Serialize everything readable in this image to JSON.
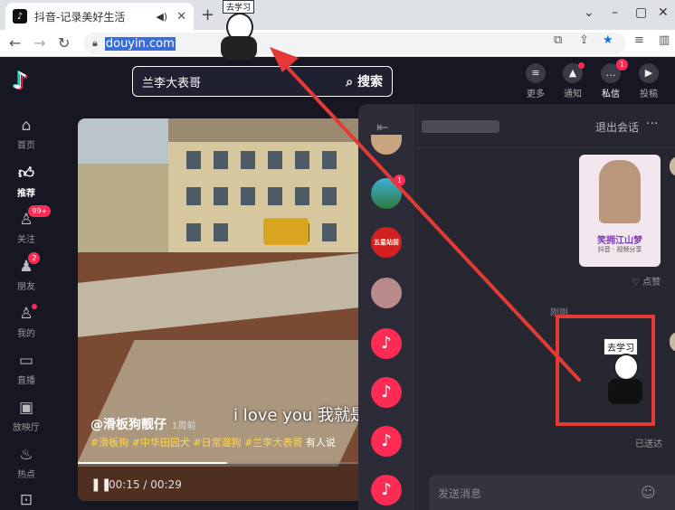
{
  "browser": {
    "tab_title": "抖音-记录美好生活",
    "url": "douyin.com",
    "accent": "#1a73e8"
  },
  "header": {
    "search_value": "兰李大表哥",
    "search_button": "搜索",
    "items": [
      {
        "label": "更多",
        "icon": "menu-icon"
      },
      {
        "label": "通知",
        "icon": "bell-icon"
      },
      {
        "label": "私信",
        "icon": "message-icon",
        "badge": "1"
      },
      {
        "label": "投稿",
        "icon": "upload-icon"
      }
    ]
  },
  "sidebar": {
    "items": [
      {
        "label": "首页",
        "icon": "home-icon"
      },
      {
        "label": "推荐",
        "icon": "thumbs-up-icon"
      },
      {
        "label": "关注",
        "icon": "follow-icon",
        "badge": "99+"
      },
      {
        "label": "朋友",
        "icon": "friends-icon",
        "badge": "2"
      },
      {
        "label": "我的",
        "icon": "profile-icon"
      },
      {
        "label": "直播",
        "icon": "live-icon"
      },
      {
        "label": "放映厅",
        "icon": "tv-icon"
      },
      {
        "label": "热点",
        "icon": "flame-icon"
      }
    ]
  },
  "video": {
    "author": "@滑板狗靓仔",
    "time_ago": "1周前",
    "subtitle": "i love you 我就是",
    "tags": "#滑板狗 #中华田园犬 #日常遛狗 #兰李大表哥",
    "tags_extra": "有人说",
    "current_time": "00:15",
    "duration": "00:29",
    "progress": 0.517
  },
  "chat": {
    "exit_label": "退出会话",
    "more_label": "···",
    "contact_badge": "1",
    "contact_label": "五星站前",
    "card_title": "笑拥江山梦",
    "card_sub": "抖音 · 视频分享",
    "like_label": "♡ 点赞",
    "timestamp": "刚刚",
    "sticker_text": "去学习",
    "sent_label": "已送达",
    "input_placeholder": "发送消息",
    "highlight_color": "#e53935"
  },
  "floating_sticker_text": "去学习"
}
